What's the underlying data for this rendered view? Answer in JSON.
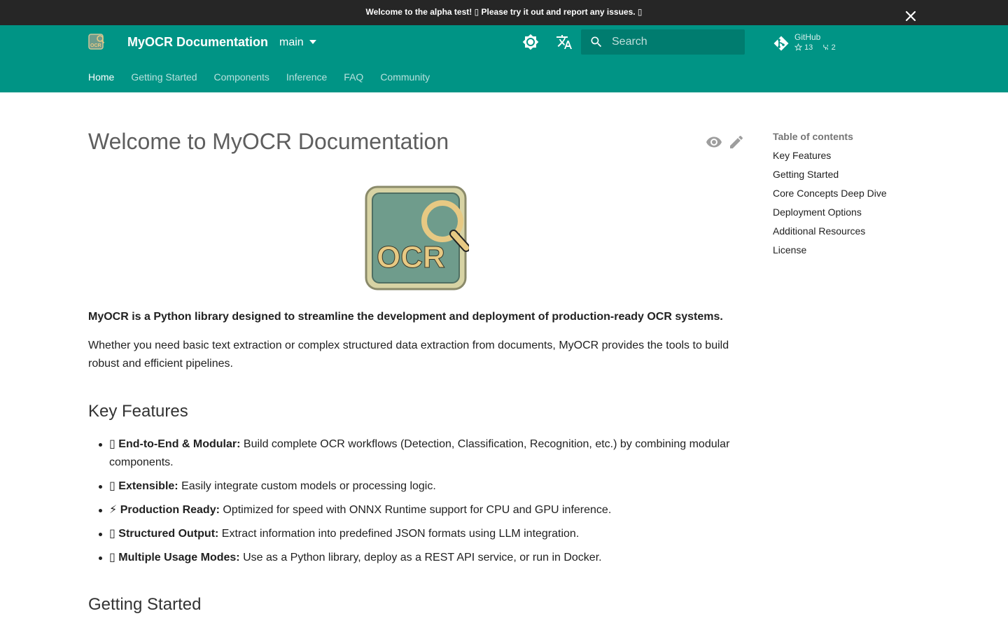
{
  "banner": {
    "text": "Welcome to the alpha test! ▯ Please try it out and report any issues. ▯"
  },
  "header": {
    "site_title": "MyOCR Documentation",
    "version": "main",
    "search_placeholder": "Search",
    "repo": {
      "name": "GitHub",
      "stars": "13",
      "forks": "2"
    },
    "tabs": [
      {
        "label": "Home",
        "active": true
      },
      {
        "label": "Getting Started",
        "active": false
      },
      {
        "label": "Components",
        "active": false
      },
      {
        "label": "Inference",
        "active": false
      },
      {
        "label": "FAQ",
        "active": false
      },
      {
        "label": "Community",
        "active": false
      }
    ]
  },
  "content": {
    "title": "Welcome to MyOCR Documentation",
    "lead": "MyOCR is a Python library designed to streamline the development and deployment of production-ready OCR systems.",
    "intro": "Whether you need basic text extraction or complex structured data extraction from documents, MyOCR provides the tools to build robust and efficient pipelines.",
    "key_features_heading": "Key Features",
    "features": [
      {
        "icon": "▯",
        "title": "End-to-End & Modular:",
        "text": " Build complete OCR workflows (Detection, Classification, Recognition, etc.) by combining modular components."
      },
      {
        "icon": "▯",
        "title": "Extensible:",
        "text": " Easily integrate custom models or processing logic."
      },
      {
        "icon": "⚡",
        "title": "Production Ready:",
        "text": " Optimized for speed with ONNX Runtime support for CPU and GPU inference."
      },
      {
        "icon": "▯",
        "title": "Structured Output:",
        "text": " Extract information into predefined JSON formats using LLM integration."
      },
      {
        "icon": "▯",
        "title": "Multiple Usage Modes:",
        "text": " Use as a Python library, deploy as a REST API service, or run in Docker."
      }
    ],
    "getting_started_heading": "Getting Started"
  },
  "toc": {
    "title": "Table of contents",
    "items": [
      "Key Features",
      "Getting Started",
      "Core Concepts Deep Dive",
      "Deployment Options",
      "Additional Resources",
      "License"
    ]
  },
  "logo": {
    "text": "OCR"
  },
  "colors": {
    "primary": "#009485",
    "banner": "#262626",
    "logo_fill": "#6f9c8c",
    "logo_accent": "#e7c983"
  }
}
